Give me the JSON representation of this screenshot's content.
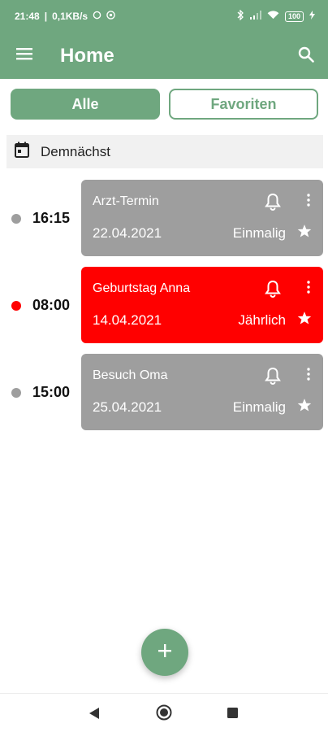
{
  "status_bar": {
    "time": "21:48",
    "speed": "0,1KB/s",
    "battery": "100"
  },
  "app_bar": {
    "title": "Home"
  },
  "filter": {
    "all_label": "Alle",
    "favorites_label": "Favoriten"
  },
  "section": {
    "label": "Demnächst"
  },
  "events": [
    {
      "time": "16:15",
      "title": "Arzt-Termin",
      "date": "22.04.2021",
      "repeat": "Einmalig",
      "color": "#9e9e9e"
    },
    {
      "time": "08:00",
      "title": "Geburtstag Anna",
      "date": "14.04.2021",
      "repeat": "Jährlich",
      "color": "#ff0000"
    },
    {
      "time": "15:00",
      "title": "Besuch Oma",
      "date": "25.04.2021",
      "repeat": "Einmalig",
      "color": "#9e9e9e"
    }
  ],
  "colors": {
    "primary": "#6fa77f",
    "event_gray": "#9e9e9e",
    "event_red": "#ff0000"
  },
  "icons": [
    "menu-icon",
    "search-icon",
    "calendar-icon",
    "bell-icon",
    "more-vert-icon",
    "star-icon",
    "plus-icon",
    "nav-back-icon",
    "nav-home-icon",
    "nav-recent-icon"
  ]
}
